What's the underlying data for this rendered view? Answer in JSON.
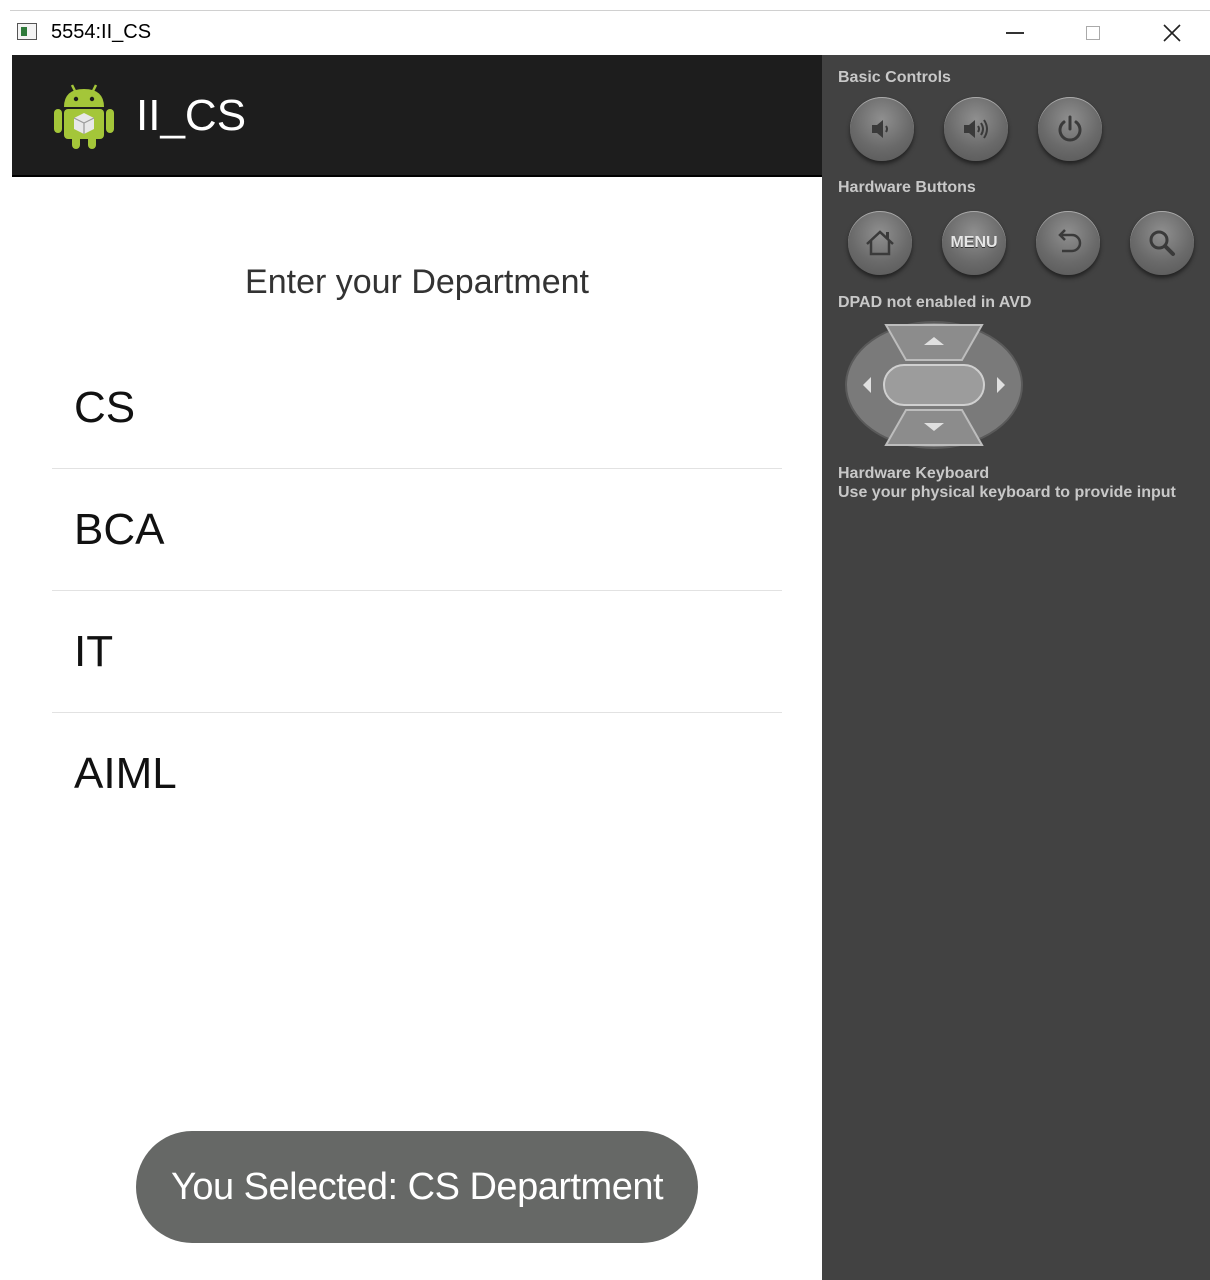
{
  "window": {
    "title": "5554:II_CS"
  },
  "app": {
    "title": "II_CS",
    "prompt": "Enter your Department",
    "departments": [
      "CS",
      "BCA",
      "IT",
      "AIML"
    ],
    "toast": "You Selected: CS Department"
  },
  "controls": {
    "basic_label": "Basic Controls",
    "hardware_label": "Hardware Buttons",
    "menu_label": "MENU",
    "dpad_label": "DPAD not enabled in AVD",
    "keyboard_title": "Hardware Keyboard",
    "keyboard_desc": "Use your physical keyboard to provide input"
  },
  "colors": {
    "actionbar": "#1d1d1d",
    "panel": "#424242",
    "toast": "#666866",
    "android_green": "#a4c639"
  },
  "icons": [
    "window-app-icon",
    "minimize-icon",
    "maximize-icon",
    "close-icon",
    "android-logo",
    "volume-down-icon",
    "volume-up-icon",
    "power-icon",
    "home-icon",
    "back-icon",
    "search-icon",
    "dpad-up-icon",
    "dpad-down-icon",
    "dpad-left-icon",
    "dpad-right-icon"
  ]
}
